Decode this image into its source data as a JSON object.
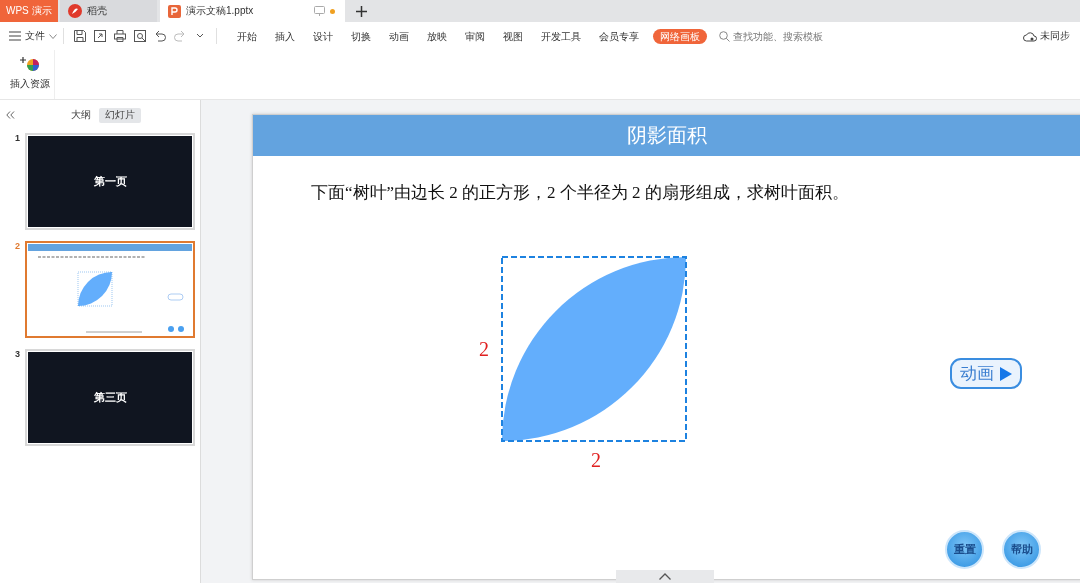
{
  "app_tabs": [
    {
      "label": "WPS 演示",
      "kind": "brand",
      "selected": false
    },
    {
      "label": "稻壳",
      "kind": "docer",
      "selected": false
    },
    {
      "label": "演示文稿1.pptx",
      "kind": "doc",
      "selected": true,
      "modified": true
    }
  ],
  "toolbar": {
    "file_menu": "文件",
    "ribbon_tabs": [
      {
        "label": "开始",
        "highlighted": false
      },
      {
        "label": "插入",
        "highlighted": false
      },
      {
        "label": "设计",
        "highlighted": false
      },
      {
        "label": "切换",
        "highlighted": false
      },
      {
        "label": "动画",
        "highlighted": false
      },
      {
        "label": "放映",
        "highlighted": false
      },
      {
        "label": "审阅",
        "highlighted": false
      },
      {
        "label": "视图",
        "highlighted": false
      },
      {
        "label": "开发工具",
        "highlighted": false
      },
      {
        "label": "会员专享",
        "highlighted": false
      },
      {
        "label": "网络画板",
        "highlighted": true
      }
    ],
    "search": {
      "placeholder": "查找功能、搜索模板"
    },
    "sync": "未同步"
  },
  "ribbon": {
    "buttons": [
      {
        "label": "插入资源"
      }
    ]
  },
  "panel": {
    "view_tabs": [
      {
        "label": "大纲",
        "selected": false
      },
      {
        "label": "幻灯片",
        "selected": true
      }
    ],
    "slides": [
      {
        "number": "1",
        "kind": "title",
        "title": "第一页",
        "selected": false
      },
      {
        "number": "2",
        "kind": "preview",
        "selected": true
      },
      {
        "number": "3",
        "kind": "title",
        "title": "第三页",
        "selected": false
      }
    ]
  },
  "slide": {
    "title": "阴影面积",
    "question": "下面“树叶”由边长 2 的正方形，2 个半径为 2 的扇形组成，求树叶面积。",
    "side_label": "2",
    "bottom_label": "2",
    "animate_button": "动画",
    "round_buttons": [
      "重置",
      "帮助"
    ]
  }
}
